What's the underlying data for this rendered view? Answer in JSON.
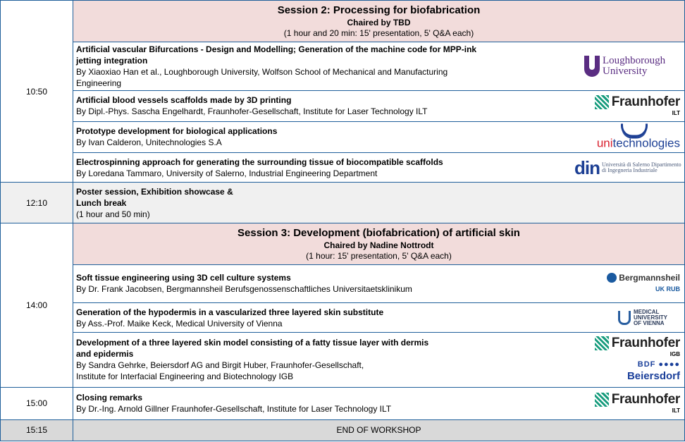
{
  "session2": {
    "time": "10:50",
    "title": "Session 2: Processing for biofabrication",
    "chair": "Chaired by TBD",
    "duration": "(1 hour and 20 min: 15' presentation, 5' Q&A each)",
    "talks": [
      {
        "title": "Artificial vascular Bifurcations - Design and Modelling; Generation of the machine code for MPP-ink jetting integration",
        "author": "By Xiaoxiao Han et al., Loughborough University, Wolfson School of Mechanical and Manufacturing Engineering",
        "logo_text": "Loughborough University"
      },
      {
        "title": "Artificial blood vessels scaffolds made by 3D printing",
        "author": "By Dipl.-Phys. Sascha Engelhardt, Fraunhofer-Gesellschaft, Institute for Laser Technology ILT",
        "logo_text": "Fraunhofer",
        "logo_sub": "ILT"
      },
      {
        "title": "Prototype development for biological applications",
        "author": "By Ivan Calderon, Unitechnologies S.A",
        "logo_text_a": "uni",
        "logo_text_b": "technologies"
      },
      {
        "title": "Electrospinning approach for generating the surrounding tissue of biocompatible scaffolds",
        "author": "By Loredana Tammaro, University of Salerno, Industrial Engineering Department",
        "logo_mark": "din",
        "logo_text": "Università di Salerno Dipartimento di Ingegneria Industriale"
      }
    ]
  },
  "break": {
    "time": "12:10",
    "line1": "Poster session, Exhibition showcase &",
    "line2": "Lunch break",
    "duration": "(1 hour and 50 min)"
  },
  "session3": {
    "time": "14:00",
    "title": "Session 3: Development (biofabrication) of artificial skin",
    "chair": "Chaired by Nadine Nottrodt",
    "duration": "(1 hour: 15' presentation, 5' Q&A each)",
    "talks": [
      {
        "title": "Soft tissue engineering using 3D cell culture systems",
        "author": "By Dr. Frank Jacobsen, Bergmannsheil Berufsgenossenschaftliches Universitaetsklinikum",
        "logo_text": "Bergmannsheil",
        "logo_rub": "UK RUB"
      },
      {
        "title": "Generation of the hypodermis in a vascularized three layered skin substitute",
        "author": "By Ass.-Prof. Maike Keck, Medical University of Vienna",
        "logo_text": "MEDICAL UNIVERSITY OF VIENNA"
      },
      {
        "title": "Development of a three layered skin model consisting of a fatty tissue layer with dermis and epidermis",
        "author": "By Sandra Gehrke, Beiersdorf AG and Birgit Huber, Fraunhofer-Gesellschaft,",
        "author2": "Institute for Interfacial Engineering and Biotechnology IGB",
        "logo_text": "Fraunhofer",
        "logo_sub": "IGB",
        "logo_bdf": "BDF ●●●●",
        "logo_beiersdorf": "Beiersdorf"
      }
    ]
  },
  "closing": {
    "time": "15:00",
    "title": "Closing remarks",
    "author": "By Dr.-Ing. Arnold Gillner Fraunhofer-Gesellschaft, Institute for Laser Technology ILT",
    "logo_text": "Fraunhofer",
    "logo_sub": "ILT"
  },
  "end": {
    "time": "15:15",
    "label": "END OF WORKSHOP"
  }
}
